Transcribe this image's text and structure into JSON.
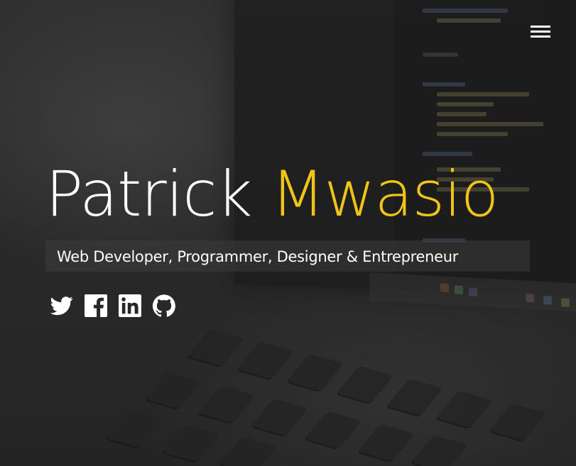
{
  "header": {
    "menu_icon": "hamburger-menu-icon"
  },
  "hero": {
    "first_name": "Patrick",
    "last_name": "Mwasio",
    "tagline": "Web Developer, Programmer, Designer & Entrepreneur",
    "accent_color": "#f0c419",
    "text_color": "#ffffff"
  },
  "socials": [
    {
      "icon": "twitter-icon"
    },
    {
      "icon": "facebook-icon"
    },
    {
      "icon": "linkedin-icon"
    },
    {
      "icon": "github-icon"
    }
  ]
}
